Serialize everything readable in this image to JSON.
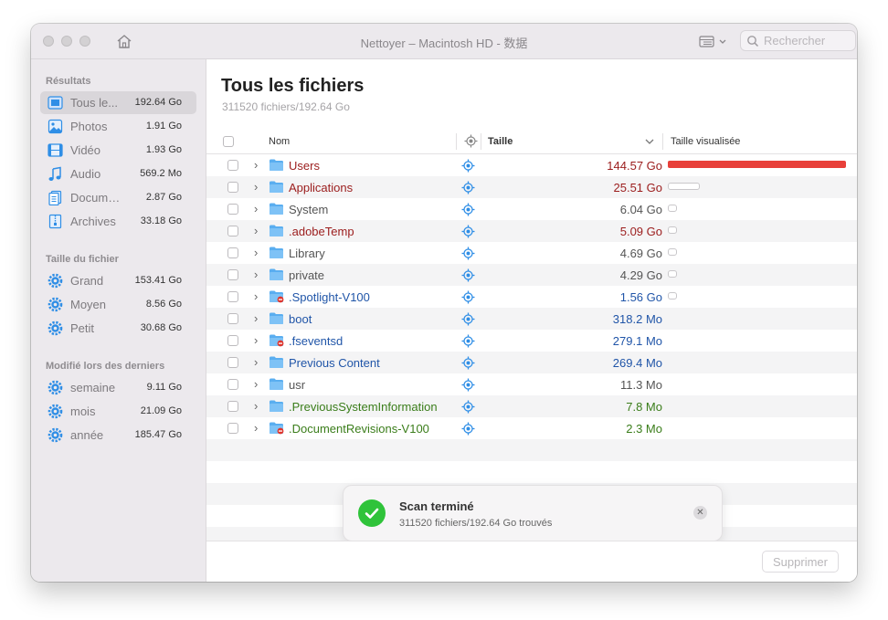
{
  "window": {
    "title": "Nettoyer – Macintosh HD - 数据",
    "search_placeholder": "Rechercher"
  },
  "sidebar": {
    "sections": [
      {
        "heading": "Résultats",
        "items": [
          {
            "label": "Tous le...",
            "size": "192.64 Go",
            "icon": "all-files-icon",
            "selected": true
          },
          {
            "label": "Photos",
            "size": "1.91 Go",
            "icon": "photos-icon"
          },
          {
            "label": "Vidéo",
            "size": "1.93 Go",
            "icon": "video-icon"
          },
          {
            "label": "Audio",
            "size": "569.2 Mo",
            "icon": "audio-icon"
          },
          {
            "label": "Documents",
            "size": "2.87 Go",
            "icon": "documents-icon"
          },
          {
            "label": "Archives",
            "size": "33.18 Go",
            "icon": "archives-icon"
          }
        ]
      },
      {
        "heading": "Taille du fichier",
        "items": [
          {
            "label": "Grand",
            "size": "153.41 Go",
            "icon": "gear-icon"
          },
          {
            "label": "Moyen",
            "size": "8.56 Go",
            "icon": "gear-icon"
          },
          {
            "label": "Petit",
            "size": "30.68 Go",
            "icon": "gear-icon"
          }
        ]
      },
      {
        "heading": "Modifié lors des derniers",
        "items": [
          {
            "label": "semaine",
            "size": "9.11 Go",
            "icon": "gear-icon"
          },
          {
            "label": "mois",
            "size": "21.09 Go",
            "icon": "gear-icon"
          },
          {
            "label": "année",
            "size": "185.47 Go",
            "icon": "gear-icon"
          }
        ]
      }
    ]
  },
  "main": {
    "title": "Tous les fichiers",
    "subtitle": "311520 fichiers/192.64 Go",
    "columns": {
      "name": "Nom",
      "size": "Taille",
      "visual": "Taille visualisée"
    },
    "rows": [
      {
        "name": "Users",
        "size": "144.57 Go",
        "color": "#9b1c1c",
        "bar": 1.0,
        "bar_kind": "fill",
        "restricted": false
      },
      {
        "name": "Applications",
        "size": "25.51 Go",
        "color": "#9b1c1c",
        "bar": 0.18,
        "bar_kind": "outline",
        "restricted": false
      },
      {
        "name": "System",
        "size": "6.04 Go",
        "color": "#555555",
        "bar": 0.05,
        "bar_kind": "outline",
        "restricted": false
      },
      {
        "name": ".adobeTemp",
        "size": "5.09 Go",
        "color": "#9b1c1c",
        "bar": 0.05,
        "bar_kind": "outline",
        "restricted": false
      },
      {
        "name": "Library",
        "size": "4.69 Go",
        "color": "#555555",
        "bar": 0.05,
        "bar_kind": "outline",
        "restricted": false
      },
      {
        "name": "private",
        "size": "4.29 Go",
        "color": "#555555",
        "bar": 0.05,
        "bar_kind": "outline",
        "restricted": false
      },
      {
        "name": ".Spotlight-V100",
        "size": "1.56 Go",
        "color": "#2055a8",
        "bar": 0.05,
        "bar_kind": "outline",
        "restricted": true
      },
      {
        "name": "boot",
        "size": "318.2 Mo",
        "color": "#2055a8",
        "bar": 0,
        "bar_kind": "none",
        "restricted": false
      },
      {
        "name": ".fseventsd",
        "size": "279.1 Mo",
        "color": "#2055a8",
        "bar": 0,
        "bar_kind": "none",
        "restricted": true
      },
      {
        "name": "Previous Content",
        "size": "269.4 Mo",
        "color": "#2055a8",
        "bar": 0,
        "bar_kind": "none",
        "restricted": false
      },
      {
        "name": "usr",
        "size": "11.3 Mo",
        "color": "#555555",
        "bar": 0,
        "bar_kind": "none",
        "restricted": false
      },
      {
        "name": ".PreviousSystemInformation",
        "size": "7.8 Mo",
        "color": "#3a7d1a",
        "bar": 0,
        "bar_kind": "none",
        "restricted": false
      },
      {
        "name": ".DocumentRevisions-V100",
        "size": "2.3 Mo",
        "color": "#3a7d1a",
        "bar": 0,
        "bar_kind": "none",
        "restricted": true
      }
    ],
    "delete_label": "Supprimer"
  },
  "toast": {
    "title": "Scan terminé",
    "message": "311520 fichiers/192.64 Go trouvés"
  },
  "colors": {
    "accent_blue": "#2f8ee6",
    "bar_red": "#e8403a",
    "success_green": "#2fc33a"
  }
}
